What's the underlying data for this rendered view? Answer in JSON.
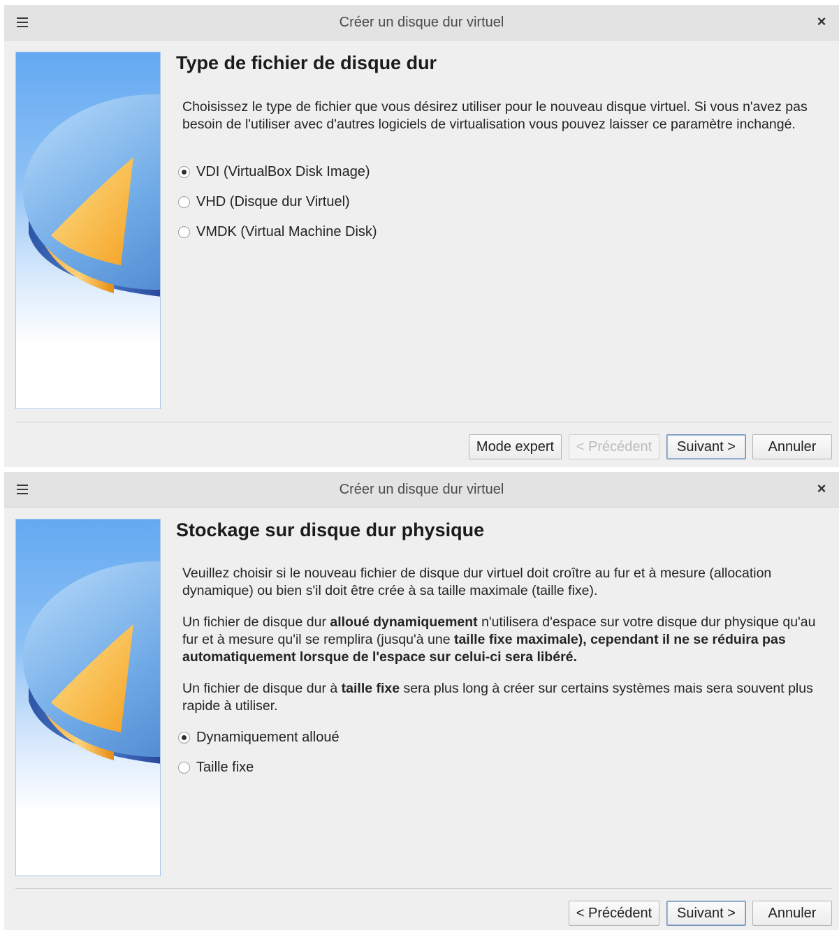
{
  "dialog1": {
    "title": "Créer un disque dur virtuel",
    "heading": "Type de fichier de disque dur",
    "description": "Choisissez le type de fichier que vous désirez utiliser pour le nouveau disque virtuel. Si vous n'avez pas besoin de l'utiliser avec d'autres logiciels de virtualisation vous pouvez laisser ce paramètre inchangé.",
    "options": [
      {
        "label": "VDI (VirtualBox Disk Image)",
        "checked": true
      },
      {
        "label": "VHD (Disque dur Virtuel)",
        "checked": false
      },
      {
        "label": "VMDK (Virtual Machine Disk)",
        "checked": false
      }
    ],
    "buttons": {
      "expert": "Mode expert",
      "previous": "< Précédent",
      "next": "Suivant >",
      "cancel": "Annuler"
    }
  },
  "dialog2": {
    "title": "Créer un disque dur virtuel",
    "heading": "Stockage sur disque dur physique",
    "para1": "Veuillez choisir si le nouveau fichier de disque dur virtuel doit croître au fur et à mesure (allocation dynamique) ou bien s'il doit être crée à sa taille maximale (taille fixe).",
    "para2": {
      "t1": "Un fichier de disque dur ",
      "b1": "alloué dynamiquement",
      "t2": " n'utilisera d'espace sur votre disque dur physique qu'au fur et à mesure qu'il se remplira (jusqu'à une ",
      "b2": "taille fixe maximale), cependant il ne se réduira pas automatiquement lorsque de l'espace sur celui-ci sera libéré."
    },
    "para3": {
      "t1": "Un fichier de disque dur à ",
      "b1": "taille fixe",
      "t2": " sera plus long à créer sur certains systèmes mais sera souvent plus rapide à utiliser."
    },
    "options": [
      {
        "label": "Dynamiquement alloué",
        "checked": true
      },
      {
        "label": "Taille fixe",
        "checked": false
      }
    ],
    "buttons": {
      "previous": "< Précédent",
      "next": "Suivant >",
      "cancel": "Annuler"
    }
  },
  "icons": {
    "menu": "hamburger-menu-icon",
    "close": "close-icon",
    "side_image": "hard-disk-pie-illustration"
  }
}
